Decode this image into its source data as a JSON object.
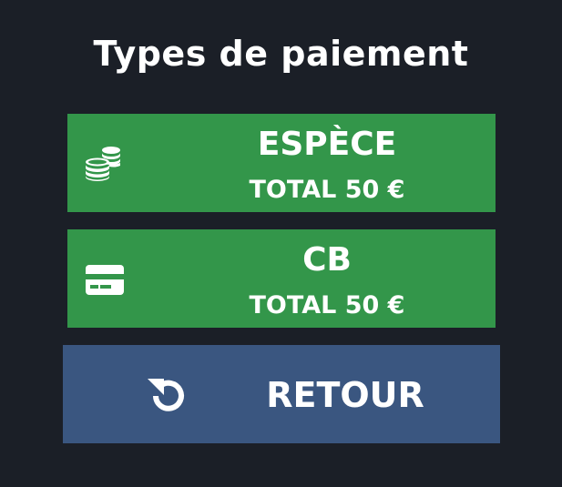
{
  "title": "Types de paiement",
  "payment_options": [
    {
      "label": "ESPÈCE",
      "total": "TOTAL 50 €",
      "icon": "coins-icon",
      "color": "#33964a"
    },
    {
      "label": "CB",
      "total": "TOTAL 50 €",
      "icon": "credit-card-icon",
      "color": "#33964a"
    }
  ],
  "back_button": {
    "label": "RETOUR",
    "icon": "undo-icon",
    "color": "#3a5680"
  },
  "colors": {
    "background": "#1b1f27",
    "text": "#ffffff"
  }
}
